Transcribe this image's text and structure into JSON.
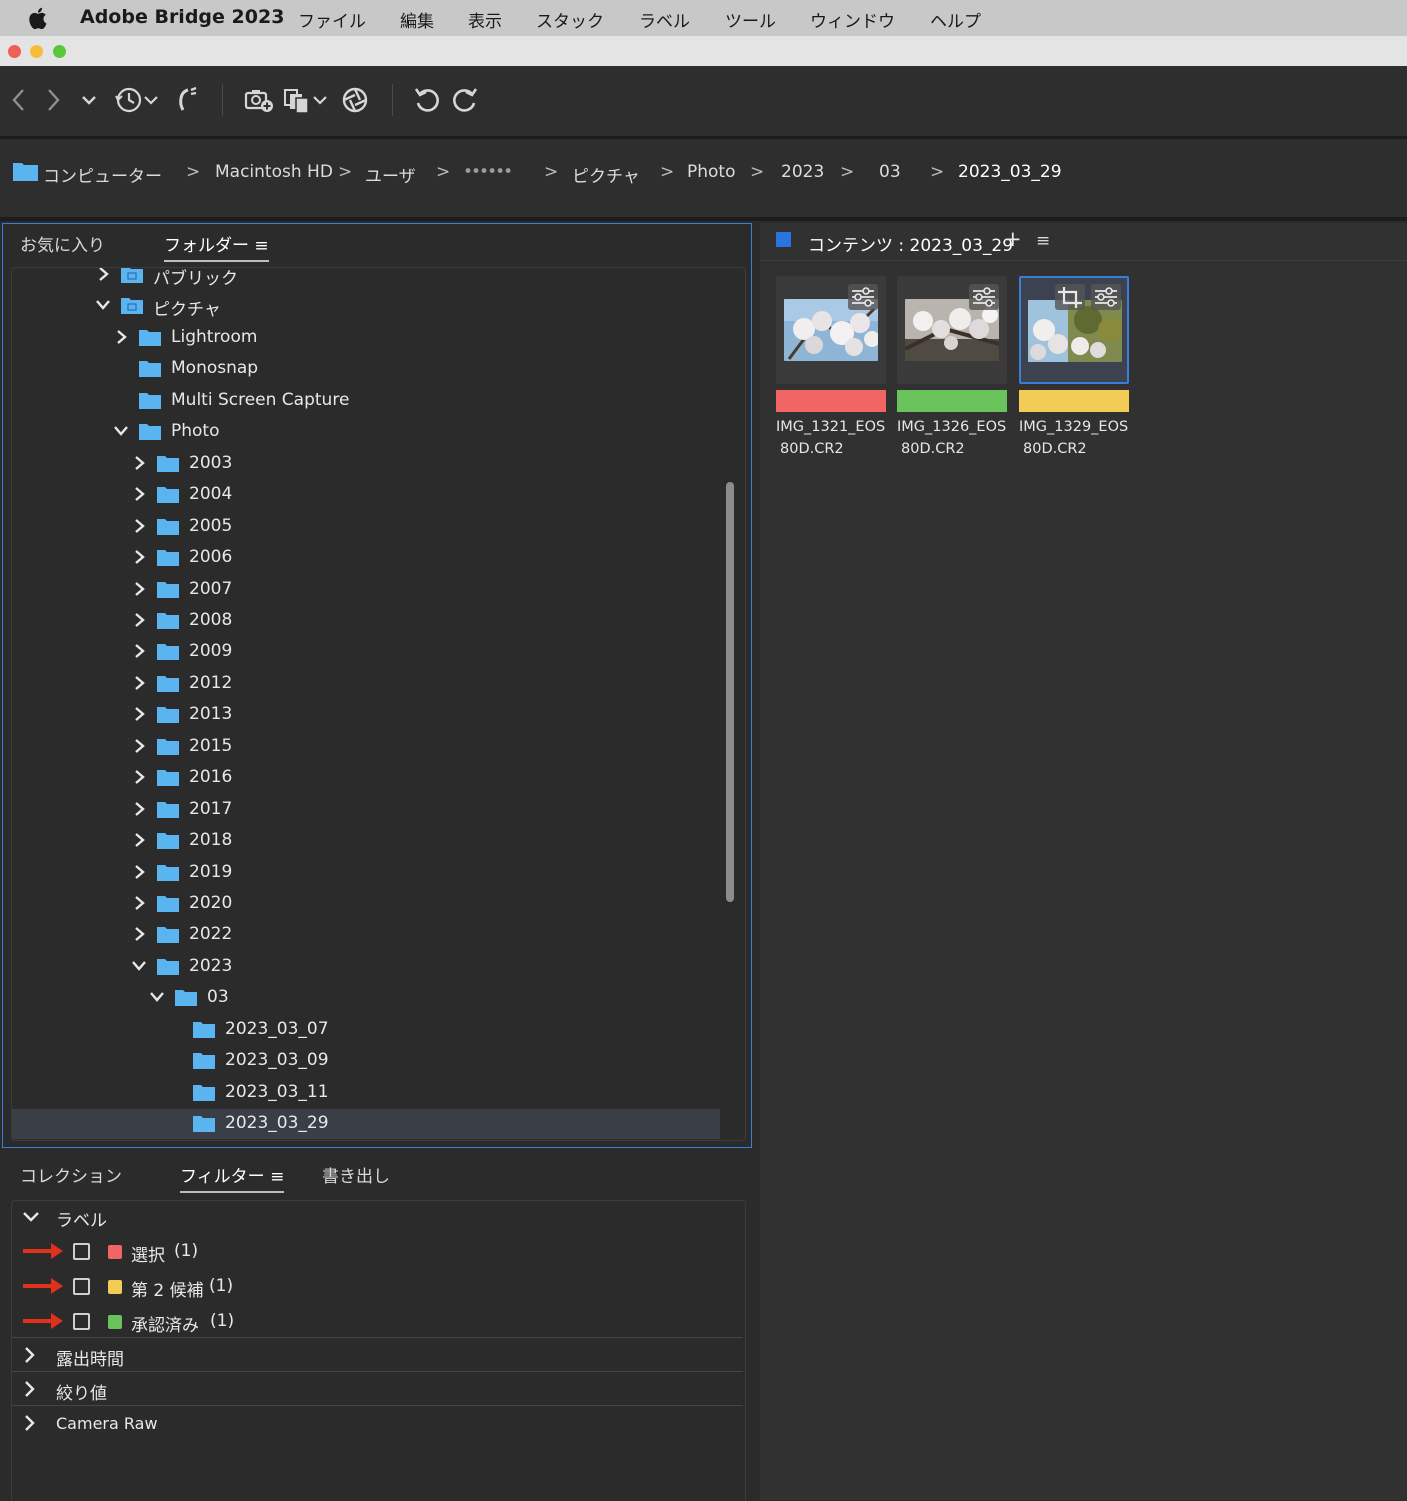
{
  "menubar": {
    "app_name": "Adobe Bridge 2023",
    "items": [
      "ファイル",
      "編集",
      "表示",
      "スタック",
      "ラベル",
      "ツール",
      "ウィンドウ",
      "ヘルプ"
    ]
  },
  "breadcrumb": {
    "items": [
      "コンピューター",
      "Macintosh HD",
      "ユーザ",
      "••••••",
      "ピクチャ",
      "Photo",
      "2023",
      "03",
      "2023_03_29"
    ],
    "separator": ">"
  },
  "folder_panel": {
    "tabs": [
      "お気に入り",
      "フォルダー"
    ],
    "active_tab": "フォルダー",
    "menu_icon": "≡",
    "tree": [
      {
        "label": "パブリック",
        "depth": 0,
        "expander": "collapsed",
        "icon": "public-folder-icon"
      },
      {
        "label": "ピクチャ",
        "depth": 0,
        "expander": "expanded",
        "icon": "pictures-folder-icon"
      },
      {
        "label": "Lightroom",
        "depth": 1,
        "expander": "collapsed",
        "icon": "folder-icon"
      },
      {
        "label": "Monosnap",
        "depth": 1,
        "expander": "none",
        "icon": "folder-icon"
      },
      {
        "label": "Multi Screen Capture",
        "depth": 1,
        "expander": "none",
        "icon": "folder-icon"
      },
      {
        "label": "Photo",
        "depth": 1,
        "expander": "expanded",
        "icon": "folder-icon"
      },
      {
        "label": "2003",
        "depth": 2,
        "expander": "collapsed",
        "icon": "folder-icon"
      },
      {
        "label": "2004",
        "depth": 2,
        "expander": "collapsed",
        "icon": "folder-icon"
      },
      {
        "label": "2005",
        "depth": 2,
        "expander": "collapsed",
        "icon": "folder-icon"
      },
      {
        "label": "2006",
        "depth": 2,
        "expander": "collapsed",
        "icon": "folder-icon"
      },
      {
        "label": "2007",
        "depth": 2,
        "expander": "collapsed",
        "icon": "folder-icon"
      },
      {
        "label": "2008",
        "depth": 2,
        "expander": "collapsed",
        "icon": "folder-icon"
      },
      {
        "label": "2009",
        "depth": 2,
        "expander": "collapsed",
        "icon": "folder-icon"
      },
      {
        "label": "2012",
        "depth": 2,
        "expander": "collapsed",
        "icon": "folder-icon"
      },
      {
        "label": "2013",
        "depth": 2,
        "expander": "collapsed",
        "icon": "folder-icon"
      },
      {
        "label": "2015",
        "depth": 2,
        "expander": "collapsed",
        "icon": "folder-icon"
      },
      {
        "label": "2016",
        "depth": 2,
        "expander": "collapsed",
        "icon": "folder-icon"
      },
      {
        "label": "2017",
        "depth": 2,
        "expander": "collapsed",
        "icon": "folder-icon"
      },
      {
        "label": "2018",
        "depth": 2,
        "expander": "collapsed",
        "icon": "folder-icon"
      },
      {
        "label": "2019",
        "depth": 2,
        "expander": "collapsed",
        "icon": "folder-icon"
      },
      {
        "label": "2020",
        "depth": 2,
        "expander": "collapsed",
        "icon": "folder-icon"
      },
      {
        "label": "2022",
        "depth": 2,
        "expander": "collapsed",
        "icon": "folder-icon"
      },
      {
        "label": "2023",
        "depth": 2,
        "expander": "expanded",
        "icon": "folder-icon"
      },
      {
        "label": "03",
        "depth": 3,
        "expander": "expanded",
        "icon": "folder-icon"
      },
      {
        "label": "2023_03_07",
        "depth": 4,
        "expander": "none",
        "icon": "folder-icon"
      },
      {
        "label": "2023_03_09",
        "depth": 4,
        "expander": "none",
        "icon": "folder-icon"
      },
      {
        "label": "2023_03_11",
        "depth": 4,
        "expander": "none",
        "icon": "folder-icon"
      },
      {
        "label": "2023_03_29",
        "depth": 4,
        "expander": "none",
        "icon": "folder-icon",
        "selected": true
      }
    ]
  },
  "content_panel": {
    "title": "コンテンツ : 2023_03_29",
    "add_icon": "+",
    "menu_icon": "≡",
    "thumbnails": [
      {
        "name_line1": "IMG_1321_EOS",
        "name_line2": "80D.CR2",
        "label_color": "#f26565",
        "badges": [
          "adjustments-icon"
        ],
        "selected": false
      },
      {
        "name_line1": "IMG_1326_EOS",
        "name_line2": "80D.CR2",
        "label_color": "#6ac35a",
        "badges": [
          "adjustments-icon"
        ],
        "selected": false
      },
      {
        "name_line1": "IMG_1329_EOS",
        "name_line2": "80D.CR2",
        "label_color": "#f2cc55",
        "badges": [
          "crop-icon",
          "adjustments-icon"
        ],
        "selected": true
      }
    ]
  },
  "filter_panel": {
    "tabs": [
      "コレクション",
      "フィルター",
      "書き出し"
    ],
    "active_tab": "フィルター",
    "menu_icon": "≡",
    "label_section": {
      "title": "ラベル",
      "items": [
        {
          "label": "選択",
          "count": "(1)",
          "color": "#f26565"
        },
        {
          "label": "第 2 候補",
          "count": "(1)",
          "color": "#f2cc55"
        },
        {
          "label": "承認済み",
          "count": "(1)",
          "color": "#6ac35a"
        }
      ]
    },
    "collapsed_sections": [
      "露出時間",
      "絞り値",
      "Camera Raw"
    ]
  },
  "colors": {
    "accent": "#3b7ed8",
    "folder": "#5ab4f0",
    "annotation_arrow": "#e0301e"
  }
}
